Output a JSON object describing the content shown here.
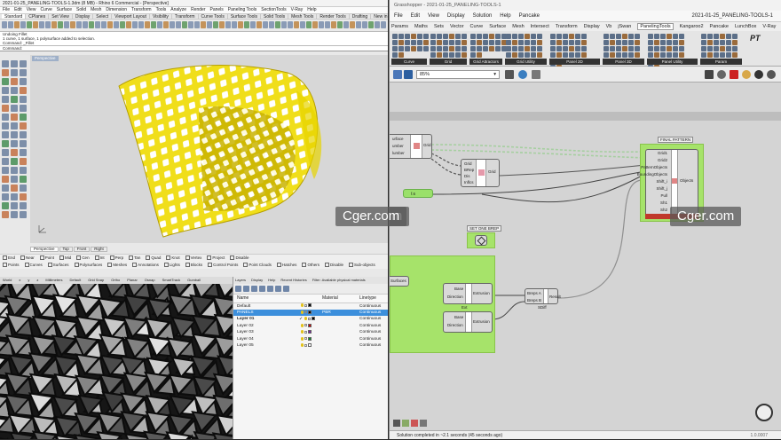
{
  "rhino": {
    "title": "2021-01-25_PANELING-TOOLS-1.3dm (8 MB) - Rhino 6 Commercial - [Perspective]",
    "menu": [
      "File",
      "Edit",
      "View",
      "Curve",
      "Surface",
      "Solid",
      "Mesh",
      "Dimension",
      "Transform",
      "Tools",
      "Analyze",
      "Render",
      "Panels",
      "Paneling Tools",
      "SectionTools",
      "V-Ray",
      "Help"
    ],
    "tabs": [
      "Standard",
      "CPlanes",
      "Set View",
      "Display",
      "Select",
      "Viewport Layout",
      "Visibility",
      "Transform",
      "Curve Tools",
      "Surface Tools",
      "Solid Tools",
      "Mesh Tools",
      "Render Tools",
      "Drafting",
      "New in V6"
    ],
    "command_history": [
      "Undoing Fillet",
      "1 curve, 1 surface, 1 polysurface added to selection.",
      "Command: _Fillet"
    ],
    "command_prompt": "Command:",
    "viewport_label": "Perspective",
    "view_tabs": [
      "Perspective",
      "Top",
      "Front",
      "Right"
    ],
    "osnap_row1": [
      "End",
      "Near",
      "Point",
      "Mid",
      "Cen",
      "Int",
      "Perp",
      "Tan",
      "Quad",
      "Knot",
      "Vertex",
      "Project",
      "Disable"
    ],
    "osnap_row2": [
      "Points",
      "Curves",
      "Surfaces",
      "Polysurfaces",
      "Meshes",
      "Annotations",
      "Lights",
      "Blocks",
      "Control Points",
      "Point Clouds",
      "Hatches",
      "Others",
      "Disable",
      "Sub-objects"
    ],
    "status_items": [
      "World",
      "x",
      "y",
      "z",
      "Millimeters",
      "Default",
      "Grid Snap",
      "Ortho",
      "Planar",
      "Osnap",
      "SmartTrack",
      "Gumball"
    ],
    "colors": {
      "surface": "#f2e21a",
      "surface_dark": "#b9a400"
    }
  },
  "layers": {
    "tabs": [
      "Layers",
      "Display",
      "Help",
      "Recent Histories",
      "Filter: Available physical materials"
    ],
    "columns": [
      "Name",
      "",
      "Material",
      "Linetype"
    ],
    "rows": [
      {
        "name": "Default",
        "check": "",
        "color": "#000000",
        "material": "",
        "linetype": "Continuous",
        "selected": false,
        "bold": false
      },
      {
        "name": "PANELS",
        "check": "",
        "color": "#000000",
        "material": "PBR",
        "linetype": "Continuous",
        "selected": true,
        "bold": false
      },
      {
        "name": "Layer 01",
        "check": "✓",
        "color": "#000000",
        "material": "",
        "linetype": "Continuous",
        "selected": false,
        "bold": true
      },
      {
        "name": "Layer 02",
        "check": "",
        "color": "#cc0000",
        "material": "",
        "linetype": "Continuous",
        "selected": false,
        "bold": false
      },
      {
        "name": "Layer 03",
        "check": "",
        "color": "#7a1fa2",
        "material": "",
        "linetype": "Continuous",
        "selected": false,
        "bold": false
      },
      {
        "name": "Layer 04",
        "check": "",
        "color": "#0a8a2a",
        "material": "",
        "linetype": "Continuous",
        "selected": false,
        "bold": false
      },
      {
        "name": "Layer 05",
        "check": "",
        "color": "#ffffff",
        "material": "",
        "linetype": "Continuous",
        "selected": false,
        "bold": false
      }
    ]
  },
  "gh": {
    "title": "Grasshopper - 2021-01-25_PANELING-TOOLS-1",
    "menu": [
      "File",
      "Edit",
      "View",
      "Display",
      "Solution",
      "Help",
      "Pancake"
    ],
    "file_name": "2021-01-25_PANELING-TOOLS-1",
    "tabs": [
      "Params",
      "Maths",
      "Sets",
      "Vector",
      "Curve",
      "Surface",
      "Mesh",
      "Intersect",
      "Transform",
      "Display",
      "Vb",
      "jSwan",
      "PanelingTools",
      "Kangaroo2",
      "Pancake",
      "LunchBox",
      "V-Ray"
    ],
    "active_tab": "PanelingTools",
    "ribbon_groups": [
      "Curve",
      "Grid",
      "Grid Attractors",
      "Grid Utility",
      "Panel 2D",
      "Panel 3D",
      "Panel Utility",
      "Param"
    ],
    "ribbon_badge": "PT",
    "zoom": "85%",
    "status": "Solution completed in ~2.1 seconds (45 seconds ago)",
    "version": "1.0.0007",
    "watermark": "Cger.com",
    "components": {
      "final_pattern": {
        "title": "FINAL PATTERN",
        "inputs": [
          "Grid1",
          "Grid2",
          "PatternObjects",
          "BoundingObjects",
          "Shift_i",
          "Shift_j",
          "Pull",
          "Sh1",
          "Sh2"
        ],
        "output": "Objects"
      },
      "grid": {
        "inputs": [
          "Grid",
          "BRep",
          "Dis",
          "Inflcs"
        ],
        "output": "Grid"
      },
      "left_partial": {
        "lines": [
          "urface",
          "umber",
          "lumber"
        ],
        "output": "Grid"
      },
      "param": {
        "label": "f.6"
      },
      "brep_param": {
        "title": "SET ONE BREP"
      },
      "surfaces": {
        "label": "Surfaces"
      },
      "extrusion1": {
        "inputs": [
          "Base",
          "Direction"
        ],
        "output": "Extrusion",
        "label": "Ext"
      },
      "extrusion2": {
        "inputs": [
          "Base",
          "Direction"
        ],
        "output": "Extrusion"
      },
      "boolean": {
        "inputs": [
          "Breps A",
          "Breps B"
        ],
        "output": "Result",
        "label": "SDiff"
      }
    }
  }
}
